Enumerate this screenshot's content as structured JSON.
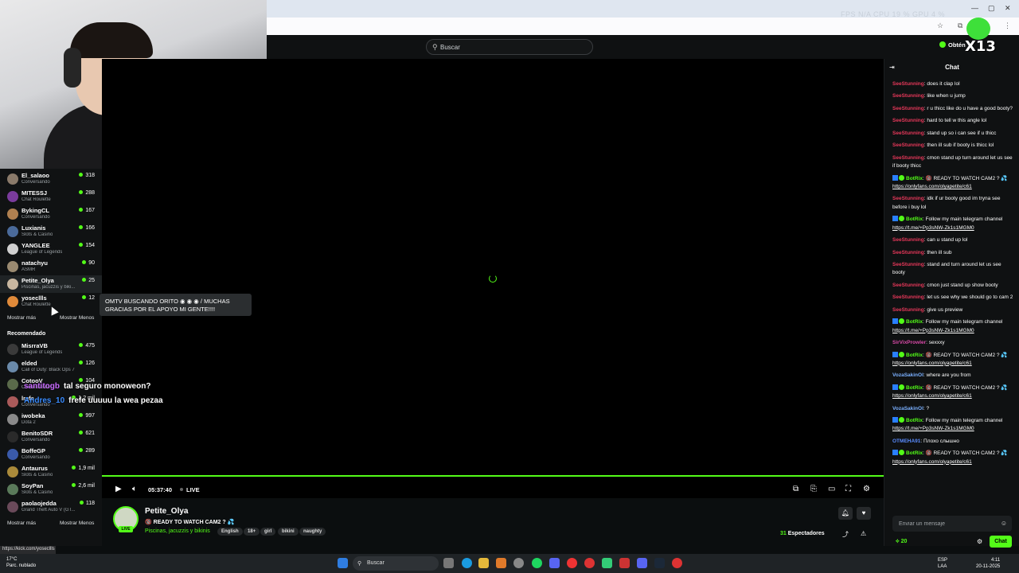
{
  "header": {
    "search_placeholder": "Buscar",
    "get_button": "Obtén",
    "fps": "FPS N/A      CPU 19 %      GPU 4 %"
  },
  "logo_text": "X13",
  "sidebar": {
    "following": [
      {
        "name": "El_salaoo",
        "category": "Conversando",
        "viewers": "318",
        "color": "#8a7a6a"
      },
      {
        "name": "MITESSJ",
        "category": "Chat Roulette",
        "viewers": "288",
        "color": "#7a3b9c"
      },
      {
        "name": "BykingCL",
        "category": "Conversando",
        "viewers": "167",
        "color": "#b08050"
      },
      {
        "name": "Luxianis",
        "category": "Slots & Casino",
        "viewers": "166",
        "color": "#4a6a9a"
      },
      {
        "name": "YANGLEE",
        "category": "League of Legends",
        "viewers": "154",
        "color": "#d0d0d0"
      },
      {
        "name": "natachyu",
        "category": "ASMR",
        "viewers": "90",
        "color": "#9a8a70"
      },
      {
        "name": "Petite_Olya",
        "category": "Piscinas, jacuzzis y biki...",
        "viewers": "25",
        "color": "#c9b7a0"
      },
      {
        "name": "yosecllls",
        "category": "Chat Roulette",
        "viewers": "12",
        "color": "#e08a3a"
      }
    ],
    "show_more": "Mostrar más",
    "show_less": "Mostrar Menos",
    "recommended_title": "Recomendado",
    "recommended": [
      {
        "name": "MisrraVB",
        "category": "League of Legends",
        "viewers": "475",
        "color": "#3a3a3a"
      },
      {
        "name": "elded",
        "category": "Call of Duty: Black Ops 7",
        "viewers": "126",
        "color": "#6a8aaa"
      },
      {
        "name": "CotooV",
        "category": "Conversando",
        "viewers": "104",
        "color": "#5a6a4a"
      },
      {
        "name": "lrefe",
        "category": "Conversando",
        "viewers": "1,2 mil",
        "color": "#aa5a5a"
      },
      {
        "name": "iwobeka",
        "category": "Dota 2",
        "viewers": "997",
        "color": "#8a8a8a"
      },
      {
        "name": "BenitoSDR",
        "category": "Conversando",
        "viewers": "621",
        "color": "#2a2a2a"
      },
      {
        "name": "BoffeGP",
        "category": "Conversando",
        "viewers": "289",
        "color": "#3a5aaa"
      },
      {
        "name": "Antaurus",
        "category": "Slots & Casino",
        "viewers": "1,9 mil",
        "color": "#aa8a3a"
      },
      {
        "name": "SoyPan",
        "category": "Slots & Casino",
        "viewers": "2,6 mil",
        "color": "#5a7a5a"
      },
      {
        "name": "paolaojedda",
        "category": "Grand Theft Auto V (GT...",
        "viewers": "118",
        "color": "#6a4a5a"
      }
    ],
    "show_more_2": "Mostrar más",
    "show_less_2": "Mostrar Menos",
    "status_url": "https://kick.com/yosecllls"
  },
  "tooltip": "OMTV BUSCANDO ORITO ◉ ◉ ◉ / MUCHAS GRACIAS POR EL APOYO MI GENTE!!!!",
  "overlay_chat": [
    {
      "user": "santitogb",
      "text": "tal seguro monoweon?",
      "color": "#c86aff"
    },
    {
      "user": "Andres_10",
      "text": "frefe uuuuu la wea pezaa",
      "color": "#3a8cff"
    }
  ],
  "player": {
    "time": "05:37:40",
    "live": "LIVE"
  },
  "stream": {
    "name": "Petite_Olya",
    "title": "🔞 READY TO WATCH CAM2 ? 💦",
    "category": "Piscinas, jacuzzis y bikinis",
    "tags": [
      "English",
      "18+",
      "girl",
      "bikini",
      "naughty"
    ],
    "live_badge": "LIVE",
    "viewers_label": "Espectadores",
    "viewers_count": "31"
  },
  "chat": {
    "title": "Chat",
    "input_placeholder": "Enviar un mensaje",
    "points": "20",
    "send_label": "Chat",
    "messages": [
      {
        "user": "SeeStunning",
        "color": "#e8385a",
        "text": "does it clap lol",
        "bot": false
      },
      {
        "user": "SeeStunning",
        "color": "#e8385a",
        "text": "like when u jump",
        "bot": false
      },
      {
        "user": "SeeStunning",
        "color": "#e8385a",
        "text": "r u thicc like do u have a good booty?",
        "bot": false
      },
      {
        "user": "SeeStunning",
        "color": "#e8385a",
        "text": "hard to tell w this angle lol",
        "bot": false
      },
      {
        "user": "SeeStunning",
        "color": "#e8385a",
        "text": "stand up so i can see if u thicc",
        "bot": false
      },
      {
        "user": "SeeStunning",
        "color": "#e8385a",
        "text": "then ill sub if booty is thicc lol",
        "bot": false
      },
      {
        "user": "SeeStunning",
        "color": "#e8385a",
        "text": "cmon stand up turn around let us see if booty thicc",
        "bot": false
      },
      {
        "user": "BotRix",
        "color": "#53fc18",
        "text": "🔞 READY TO WATCH CAM2 ? 💦",
        "link": "https://onlyfans.com/olyapetite/c61",
        "bot": true
      },
      {
        "user": "SeeStunning",
        "color": "#e8385a",
        "text": "idk if ur booty good im tryna see before i buy lol",
        "bot": false
      },
      {
        "user": "BotRix",
        "color": "#53fc18",
        "text": "Follow my main telegram channel",
        "link": "https://t.me/+Pp3sNW-Zk1s1MGM0",
        "bot": true
      },
      {
        "user": "SeeStunning",
        "color": "#e8385a",
        "text": "can u stand up lol",
        "bot": false
      },
      {
        "user": "SeeStunning",
        "color": "#e8385a",
        "text": "then ill sub",
        "bot": false
      },
      {
        "user": "SeeStunning",
        "color": "#e8385a",
        "text": "stand and turn around let us see booty",
        "bot": false
      },
      {
        "user": "SeeStunning",
        "color": "#e8385a",
        "text": "cmon just stand up show booty",
        "bot": false
      },
      {
        "user": "SeeStunning",
        "color": "#e8385a",
        "text": "let us see why we should go to cam 2",
        "bot": false
      },
      {
        "user": "SeeStunning",
        "color": "#e8385a",
        "text": "give us preview",
        "bot": false
      },
      {
        "user": "BotRix",
        "color": "#53fc18",
        "text": "Follow my main telegram channel",
        "link": "https://t.me/+Pp3sNW-Zk1s1MGM0",
        "bot": true
      },
      {
        "user": "SirVixProwler",
        "color": "#d94aa8",
        "text": "sexxxy",
        "bot": false
      },
      {
        "user": "BotRix",
        "color": "#53fc18",
        "text": "🔞 READY TO WATCH CAM2 ? 💦",
        "link": "https://onlyfans.com/olyapetite/c61",
        "bot": true
      },
      {
        "user": "VozaSakinOl",
        "color": "#7ab0ff",
        "text": "where are you from",
        "bot": false
      },
      {
        "user": "BotRix",
        "color": "#53fc18",
        "text": "🔞 READY TO WATCH CAM2 ? 💦",
        "link": "https://onlyfans.com/olyapetite/c61",
        "bot": true
      },
      {
        "user": "VozaSakinOl",
        "color": "#7ab0ff",
        "text": "?",
        "bot": false
      },
      {
        "user": "BotRix",
        "color": "#53fc18",
        "text": "Follow my main telegram channel",
        "link": "https://t.me/+Pp3sNW-Zk1s1MGM0",
        "bot": true
      },
      {
        "user": "OTMEHA91",
        "color": "#5a8cff",
        "text": "Плохо слышно",
        "bot": false
      },
      {
        "user": "BotRix",
        "color": "#53fc18",
        "text": "🔞 READY TO WATCH CAM2 ? 💦",
        "link": "https://onlyfans.com/olyapetite/c61",
        "bot": true
      }
    ]
  },
  "taskbar": {
    "temp": "17°C",
    "weather": "Parc. nublado",
    "search": "Buscar",
    "lang": "ESP\nLAA",
    "time": "4:11",
    "date": "20-11-2025"
  }
}
